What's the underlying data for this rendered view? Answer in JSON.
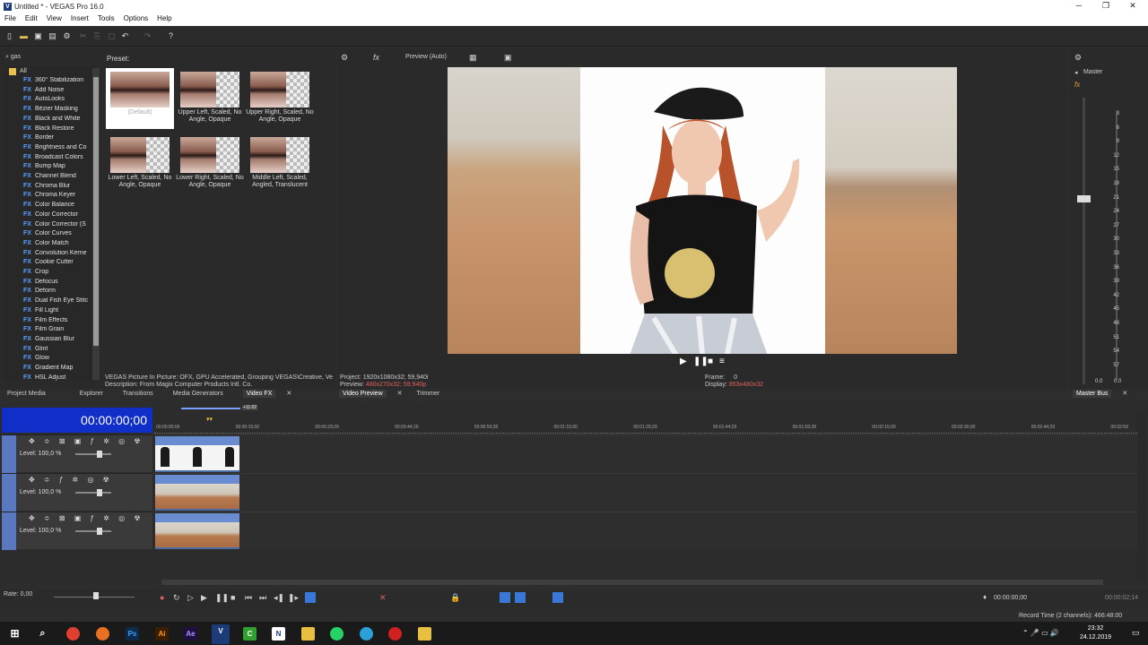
{
  "window": {
    "title": "Untitled * - VEGAS Pro 16.0",
    "logo": "V"
  },
  "menu": [
    "File",
    "Edit",
    "View",
    "Insert",
    "Tools",
    "Options",
    "Help"
  ],
  "left": {
    "search": "gas",
    "preset_label": "Preset:",
    "tree_root": "All",
    "fx_items": [
      "360° Stabilization",
      "Add Noise",
      "AutoLooks",
      "Bézier Masking",
      "Black and White",
      "Black Restore",
      "Border",
      "Brightness and Co",
      "Broadcast Colors",
      "Bump Map",
      "Channel Blend",
      "Chroma Blur",
      "Chroma Keyer",
      "Color Balance",
      "Color Corrector",
      "Color Corrector (S",
      "Color Curves",
      "Color Match",
      "Convolution Kerne",
      "Cookie Cutter",
      "Crop",
      "Defocus",
      "Deform",
      "Dual Fish Eye Stitc",
      "Fill Light",
      "Film Effects",
      "Film Grain",
      "Gaussian Blur",
      "Glint",
      "Glow",
      "Gradient Map",
      "HSL Adjust"
    ],
    "fx_tag": "FX",
    "presets": [
      {
        "caption": "(Default)"
      },
      {
        "caption": "Upper Left, Scaled, No Angle, Opaque"
      },
      {
        "caption": "Upper Right, Scaled, No Angle, Opaque"
      },
      {
        "caption": "Lower Left, Scaled, No Angle, Opaque"
      },
      {
        "caption": "Lower Right, Scaled, No Angle, Opaque"
      },
      {
        "caption": "Middle Left, Scaled, Angled, Translucent"
      }
    ],
    "description1": "VEGAS Picture In Picture: OFX, GPU Accelerated, Grouping VEGAS\\Creative, Ve",
    "description2": "Description: From Magix Computer Products Intl. Co.",
    "tabs": [
      "Project Media",
      "Explorer",
      "Transitions",
      "Media Generators",
      "Video FX"
    ]
  },
  "preview": {
    "mode": "Preview (Auto)",
    "project_label": "Project:",
    "project_value": "1920x1080x32; 59,940i",
    "preview_label": "Preview:",
    "preview_value": "480x270x32; 59,940p",
    "frame_label": "Frame:",
    "frame_value": "0",
    "display_label": "Display:",
    "display_value": "853x480x32",
    "tabs": [
      "Video Preview",
      "Trimmer"
    ]
  },
  "master": {
    "label": "Master",
    "ticks": [
      "3",
      "6",
      "9",
      "12",
      "15",
      "18",
      "21",
      "24",
      "27",
      "30",
      "33",
      "36",
      "39",
      "42",
      "45",
      "48",
      "51",
      "54",
      "57"
    ],
    "levels": [
      "0.0",
      "0.0"
    ],
    "tab": "Master Bus"
  },
  "timeline": {
    "timecode": "00:00:00;00",
    "ruler": [
      "00:00:00;00",
      "00:00:15;00",
      "00:00:29;29",
      "00:00:44;29",
      "00:00:59;28",
      "00:01:15;00",
      "00:01:29;29",
      "00:01:44;29",
      "00:01:59;28",
      "00:02:15;00",
      "00:02:30;00",
      "00:02:44;29",
      "00:02:59"
    ],
    "loop_marker": "+11:02",
    "tracks": [
      {
        "level": "Level: 100,0 %"
      },
      {
        "level": "Level: 100,0 %"
      },
      {
        "level": "Level: 100,0 %"
      }
    ],
    "rate": "Rate: 0,00",
    "cursor_time": "00:00:00;00",
    "end_time": "00:00:02;14",
    "record_time": "Record Time (2 channels): 466:48:00"
  },
  "taskbar": {
    "time": "23:32",
    "date": "24.12.2019"
  }
}
